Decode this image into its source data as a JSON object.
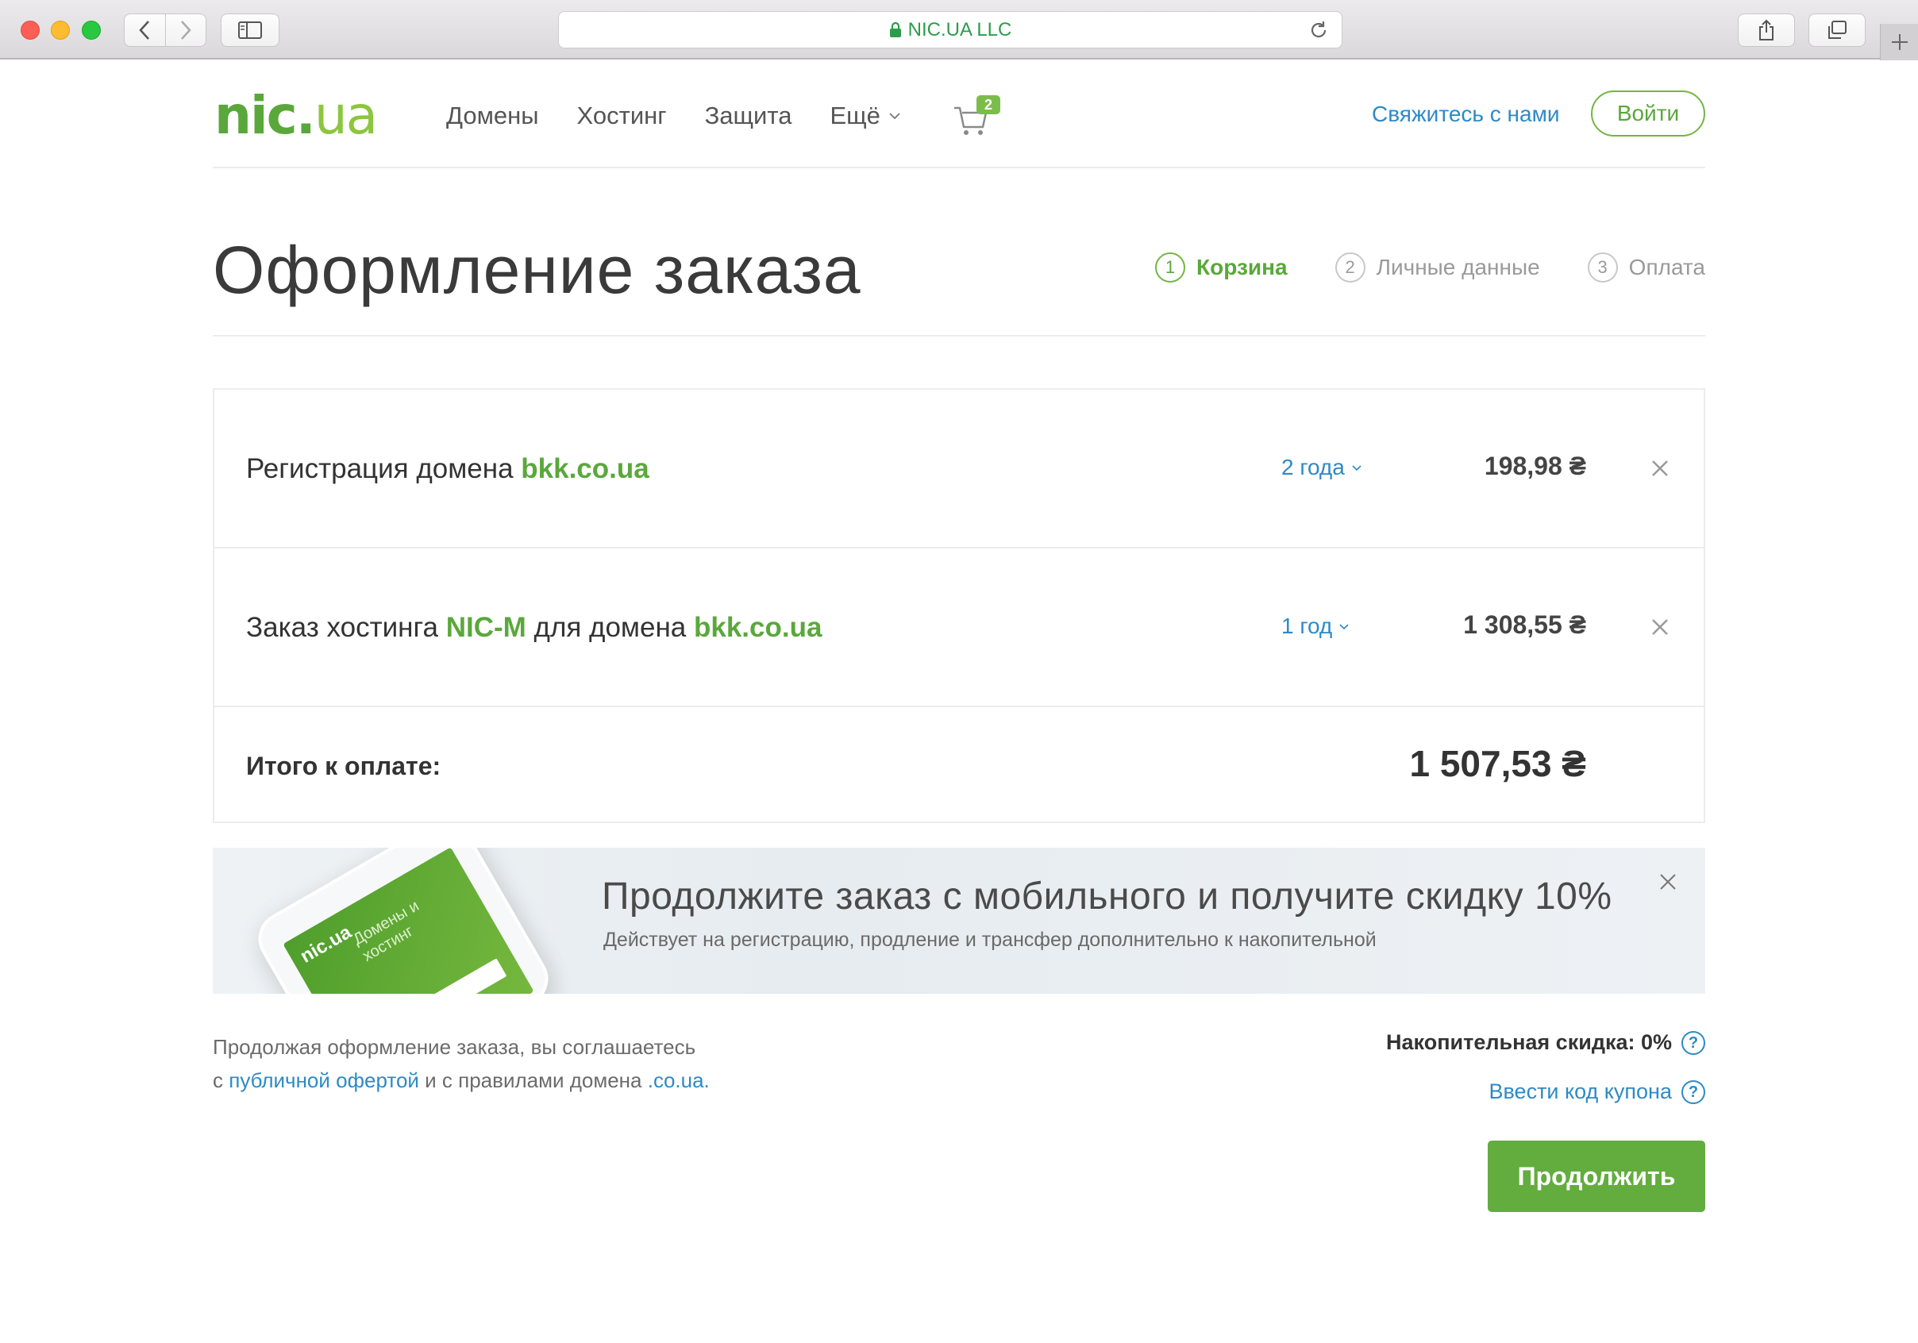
{
  "browser": {
    "url": "NIC.UA LLC"
  },
  "header": {
    "logo_part1": "nic.",
    "logo_part2": "ua",
    "nav": [
      "Домены",
      "Хостинг",
      "Защита",
      "Ещё"
    ],
    "cart_count": "2",
    "contact": "Свяжитесь с нами",
    "login": "Войти"
  },
  "checkout": {
    "title": "Оформление заказа",
    "steps": [
      {
        "num": "1",
        "label": "Корзина",
        "active": true
      },
      {
        "num": "2",
        "label": "Личные данные",
        "active": false
      },
      {
        "num": "3",
        "label": "Оплата",
        "active": false
      }
    ]
  },
  "order": {
    "items": [
      {
        "prefix": "Регистрация домена ",
        "product": "",
        "middle": "",
        "domain": "bkk.co.ua",
        "period": "2 года",
        "price": "198,98 ₴"
      },
      {
        "prefix": "Заказ хостинга ",
        "product": "NIC-M",
        "middle": " для домена ",
        "domain": "bkk.co.ua",
        "period": "1 год",
        "price": "1 308,55 ₴"
      }
    ],
    "total_label": "Итого к оплате:",
    "total_amount": "1 507,53 ₴"
  },
  "promo": {
    "headline": "Продолжите заказ с мобильного и получите скидку 10%",
    "sub": "Действует на регистрацию, продление и трансфер дополнительно к накопительной",
    "phone_logo": "nic.ua",
    "phone_text": "Домены и хостинг"
  },
  "footer": {
    "agree_line1": "Продолжая оформление заказа, вы соглашаетесь",
    "agree_pre": "с ",
    "agree_link1": "публичной офертой",
    "agree_mid": " и с правилами домена ",
    "agree_link2": ".co.ua.",
    "discount": "Накопительная скидка: 0%",
    "coupon": "Ввести код купона",
    "continue": "Продолжить"
  },
  "colors": {
    "brand_green": "#5aa83b",
    "link_blue": "#2d8ac6",
    "button_green": "#62ad3e"
  }
}
